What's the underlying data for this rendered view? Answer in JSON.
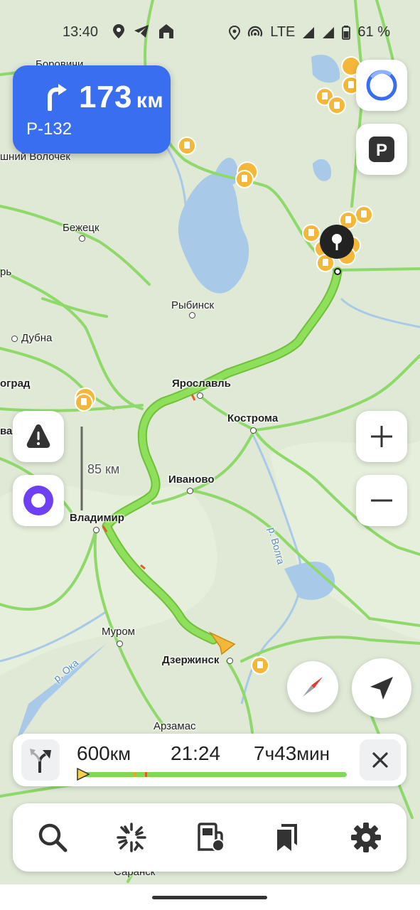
{
  "status_bar": {
    "time": "13:40",
    "network": "LTE",
    "battery": "61 %"
  },
  "maneuver": {
    "distance": "173",
    "distance_unit": "км",
    "road": "Р-132"
  },
  "map": {
    "labels": {
      "borovichi": "Боровичи",
      "vyshny_volochek": "шний Волочек",
      "bezhetsk": "Бежецк",
      "rybinsk": "Рыбинск",
      "dubna": "Дубна",
      "ograd": "оград",
      "yaroslavl": "Ярославль",
      "kostroma": "Кострома",
      "ivanovo": "Иваново",
      "vladimir": "Владимир",
      "murom": "Муром",
      "dzerzhinsk": "Дзержинск",
      "arzamas": "Арзамас",
      "saransk": "Саранск",
      "volga": "р. Волга",
      "oka": "р. Ока",
      "rzh": "рь",
      "va": "ва"
    },
    "scale": "85 км"
  },
  "route_summary": {
    "distance": "600",
    "distance_unit": "км",
    "arrival": "21:24",
    "duration_h": "7",
    "duration_h_unit": "ч",
    "duration_m": "43",
    "duration_m_unit": "мин",
    "progress": 0.0
  },
  "icons": {
    "assistant": "alice-icon",
    "parking": "parking-icon",
    "report": "warning-icon",
    "compass": "compass-icon",
    "locate": "navigation-arrow-icon",
    "search": "search-icon",
    "traffic": "traffic-icon",
    "fuel": "gas-station-icon",
    "bookmarks": "bookmarks-icon",
    "settings": "gear-icon"
  },
  "colors": {
    "route": "#7ed957",
    "road": "#8fd86a",
    "accent": "#3a6ef0",
    "water": "#a6c8ea",
    "poi": "#f4b73a"
  }
}
